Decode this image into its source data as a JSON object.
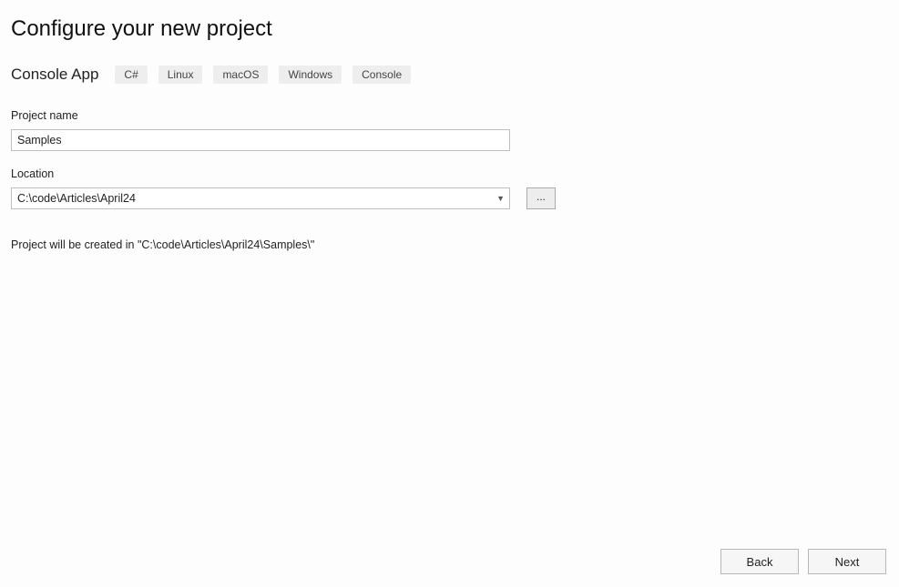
{
  "title": "Configure your new project",
  "template": {
    "name": "Console App",
    "tags": [
      "C#",
      "Linux",
      "macOS",
      "Windows",
      "Console"
    ]
  },
  "fields": {
    "project_name": {
      "label": "Project name",
      "value": "Samples"
    },
    "location": {
      "label": "Location",
      "value": "C:\\code\\Articles\\April24",
      "browse_label": "..."
    }
  },
  "preview": "Project will be created in \"C:\\code\\Articles\\April24\\Samples\\\"",
  "footer": {
    "back": "Back",
    "next": "Next"
  }
}
